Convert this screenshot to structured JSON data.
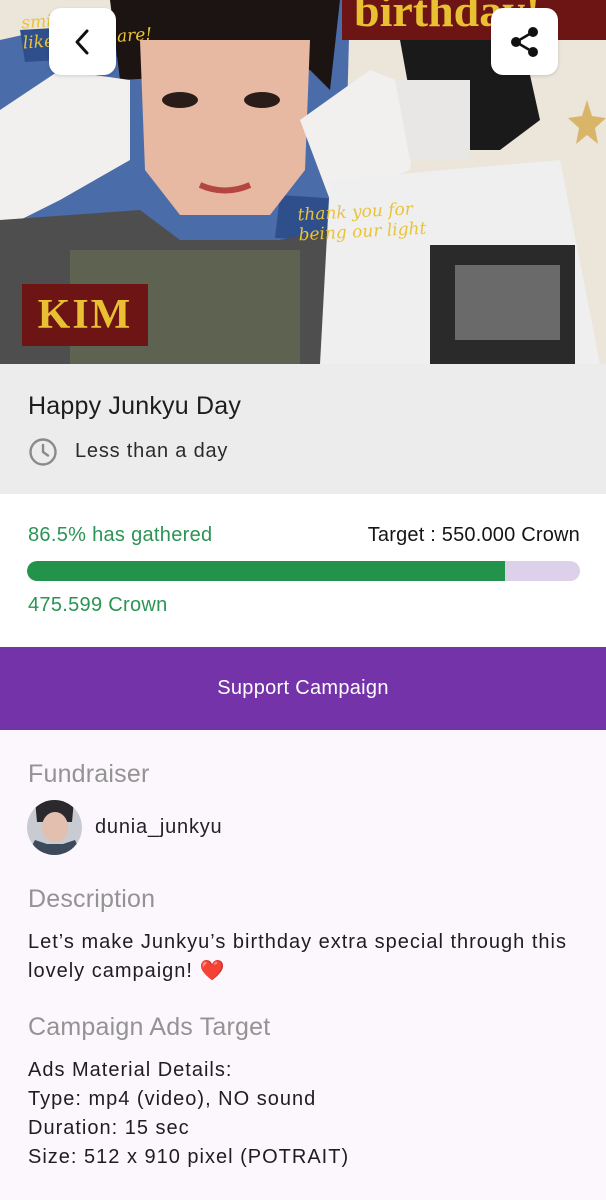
{
  "hero": {
    "caption_top_line1": "smiling",
    "caption_top_line2": "like ... you are!",
    "caption_mid_line1": "thank you for",
    "caption_mid_line2": "being our light",
    "name_tag": "KIM",
    "birthday_tag": "birthday!"
  },
  "campaign": {
    "title": "Happy Junkyu Day",
    "time_left": "Less than a day"
  },
  "progress": {
    "gathered_label": "86.5% has gathered",
    "target_label": "Target : 550.000 Crown",
    "collected_label": "475.599 Crown",
    "percent": 86.5
  },
  "actions": {
    "support_label": "Support Campaign"
  },
  "fundraiser": {
    "heading": "Fundraiser",
    "username": "dunia_junkyu"
  },
  "description": {
    "heading": "Description",
    "text": "Let’s make Junkyu’s birthday extra special through this lovely campaign!",
    "emoji": "❤️"
  },
  "ads_target": {
    "heading": "Campaign Ads Target",
    "lines": [
      "Ads Material Details:",
      "Type: mp4 (video), NO sound",
      "Duration: 15 sec",
      "Size: 512 x 910 pixel (POTRAIT)"
    ]
  },
  "colors": {
    "accent_purple": "#7433a8",
    "progress_green": "#23934b",
    "track_lilac": "#ddd0ea",
    "banner_red": "#6d1515",
    "banner_yellow": "#e8c031"
  },
  "icons": {
    "back": "chevron-left-icon",
    "share": "share-icon",
    "time": "clock-icon"
  }
}
